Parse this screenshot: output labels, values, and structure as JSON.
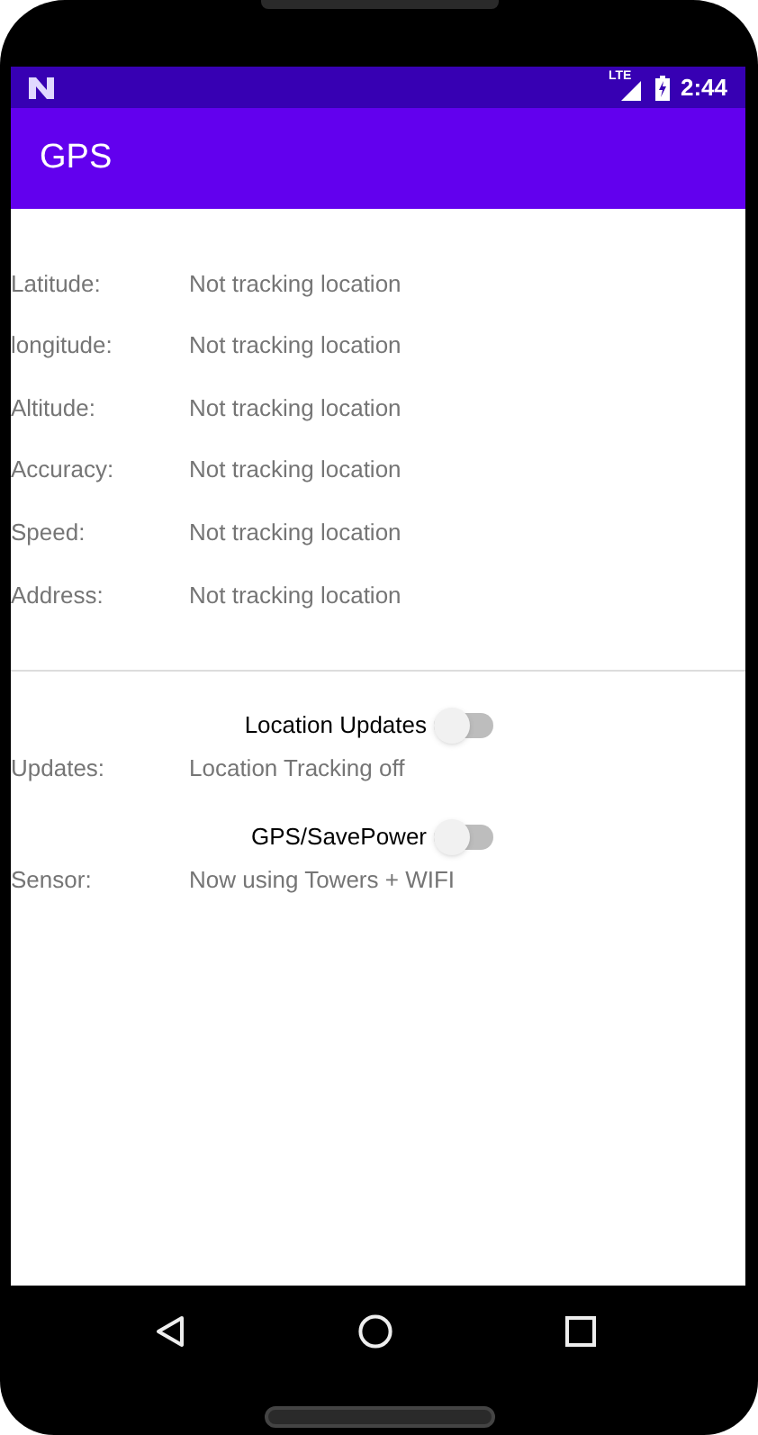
{
  "status_bar": {
    "network_label": "LTE",
    "time": "2:44"
  },
  "app_bar": {
    "title": "GPS"
  },
  "fields": [
    {
      "label": "Latitude:",
      "value": "Not tracking location"
    },
    {
      "label": "longitude:",
      "value": "Not tracking location"
    },
    {
      "label": "Altitude:",
      "value": "Not tracking location"
    },
    {
      "label": "Accuracy:",
      "value": "Not tracking location"
    },
    {
      "label": "Speed:",
      "value": "Not tracking location"
    },
    {
      "label": "Address:",
      "value": "Not tracking location"
    }
  ],
  "controls": [
    {
      "kind": "switch",
      "label": "Location Updates",
      "on": false
    },
    {
      "kind": "field",
      "label": "Updates:",
      "value": "Location Tracking off"
    },
    {
      "kind": "switch",
      "label": "GPS/SavePower",
      "on": false
    },
    {
      "kind": "field",
      "label": "Sensor:",
      "value": "Now using Towers + WIFI"
    }
  ]
}
